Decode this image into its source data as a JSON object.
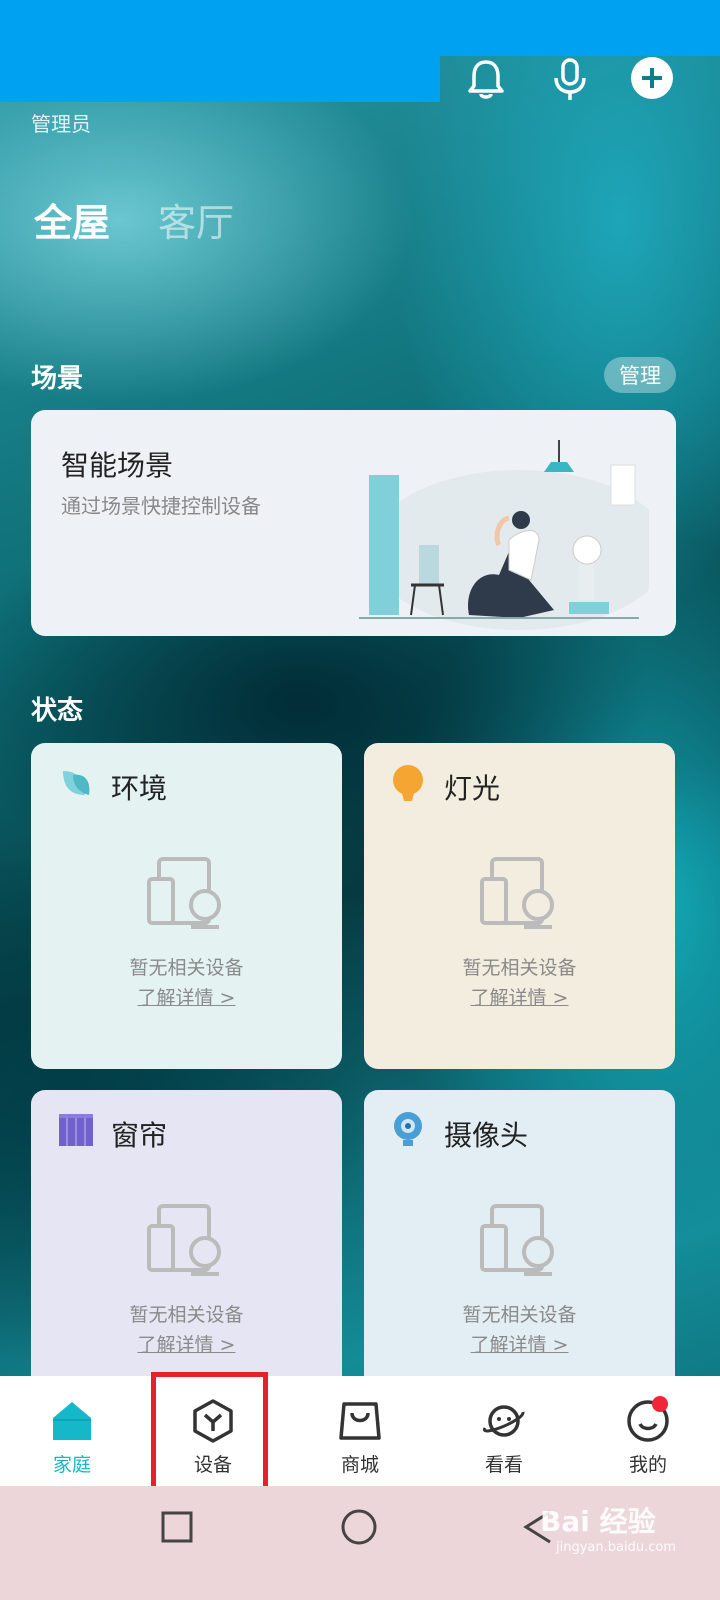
{
  "header": {
    "role": "管理员",
    "icons": [
      "bell-icon",
      "microphone-icon",
      "add-icon"
    ]
  },
  "tabs": [
    {
      "label": "全屋",
      "active": true
    },
    {
      "label": "客厅",
      "active": false
    }
  ],
  "scenes": {
    "title": "场景",
    "manage_label": "管理",
    "card_title": "智能场景",
    "card_subtitle": "通过场景快捷控制设备"
  },
  "status": {
    "title": "状态",
    "cards": [
      {
        "title": "环境",
        "icon": "leaf-icon",
        "empty": "暂无相关设备",
        "link": "了解详情 >",
        "bg": "#e6f3f3"
      },
      {
        "title": "灯光",
        "icon": "bulb-icon",
        "empty": "暂无相关设备",
        "link": "了解详情 >",
        "bg": "#f3ede1"
      },
      {
        "title": "窗帘",
        "icon": "curtain-icon",
        "empty": "暂无相关设备",
        "link": "了解详情 >",
        "bg": "#e7e6f3"
      },
      {
        "title": "摄像头",
        "icon": "camera-icon",
        "empty": "暂无相关设备",
        "link": "了解详情 >",
        "bg": "#e3eef4"
      }
    ]
  },
  "bottom_nav": [
    {
      "label": "家庭",
      "icon": "home-icon",
      "active": true
    },
    {
      "label": "设备",
      "icon": "device-icon",
      "active": false
    },
    {
      "label": "商城",
      "icon": "shopping-bag-icon",
      "active": false
    },
    {
      "label": "看看",
      "icon": "planet-icon",
      "active": false
    },
    {
      "label": "我的",
      "icon": "smiley-icon",
      "active": false,
      "badge": true
    }
  ],
  "system_nav": [
    "recent-apps-icon",
    "home-circle-icon",
    "back-icon"
  ],
  "watermark": {
    "main": "Bai 经验",
    "sub": "jingyan.baidu.com"
  },
  "colors": {
    "accent": "#14b8c8",
    "highlight": "#e8202a",
    "topbar": "#00a1f0"
  }
}
